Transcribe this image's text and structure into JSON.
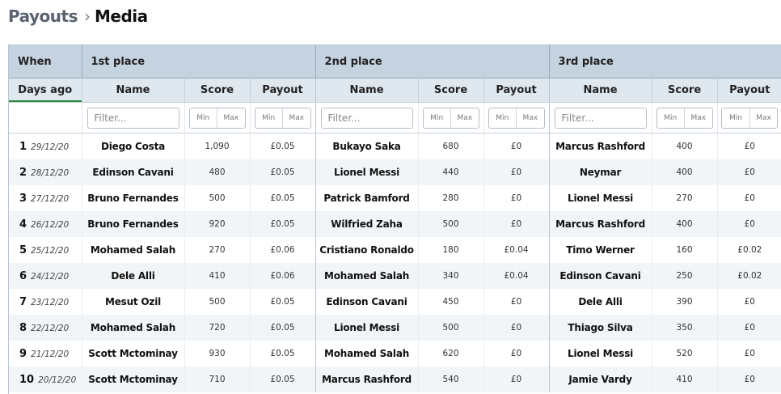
{
  "breadcrumb": {
    "parent": "Payouts",
    "separator": "›",
    "current": "Media"
  },
  "table": {
    "groups": [
      "When",
      "1st place",
      "2nd place",
      "3rd place"
    ],
    "columns": [
      "Days ago",
      "Name",
      "Score",
      "Payout",
      "Name",
      "Score",
      "Payout",
      "Name",
      "Score",
      "Payout"
    ],
    "filters": {
      "text_placeholder": "Filter...",
      "min_placeholder": "Min",
      "max_placeholder": "Max"
    },
    "rows": [
      {
        "rank": "1",
        "date": "29/12/20",
        "first": {
          "name": "Diego Costa",
          "score": "1,090",
          "payout": "£0.05"
        },
        "second": {
          "name": "Bukayo Saka",
          "score": "680",
          "payout": "£0"
        },
        "third": {
          "name": "Marcus Rashford",
          "score": "400",
          "payout": "£0"
        }
      },
      {
        "rank": "2",
        "date": "28/12/20",
        "first": {
          "name": "Edinson Cavani",
          "score": "480",
          "payout": "£0.05"
        },
        "second": {
          "name": "Lionel Messi",
          "score": "440",
          "payout": "£0"
        },
        "third": {
          "name": "Neymar",
          "score": "400",
          "payout": "£0"
        }
      },
      {
        "rank": "3",
        "date": "27/12/20",
        "first": {
          "name": "Bruno Fernandes",
          "score": "500",
          "payout": "£0.05"
        },
        "second": {
          "name": "Patrick Bamford",
          "score": "280",
          "payout": "£0"
        },
        "third": {
          "name": "Lionel Messi",
          "score": "270",
          "payout": "£0"
        }
      },
      {
        "rank": "4",
        "date": "26/12/20",
        "first": {
          "name": "Bruno Fernandes",
          "score": "920",
          "payout": "£0.05"
        },
        "second": {
          "name": "Wilfried Zaha",
          "score": "500",
          "payout": "£0"
        },
        "third": {
          "name": "Marcus Rashford",
          "score": "400",
          "payout": "£0"
        }
      },
      {
        "rank": "5",
        "date": "25/12/20",
        "first": {
          "name": "Mohamed Salah",
          "score": "270",
          "payout": "£0.06"
        },
        "second": {
          "name": "Cristiano Ronaldo",
          "score": "180",
          "payout": "£0.04"
        },
        "third": {
          "name": "Timo Werner",
          "score": "160",
          "payout": "£0.02"
        }
      },
      {
        "rank": "6",
        "date": "24/12/20",
        "first": {
          "name": "Dele Alli",
          "score": "410",
          "payout": "£0.06"
        },
        "second": {
          "name": "Mohamed Salah",
          "score": "340",
          "payout": "£0.04"
        },
        "third": {
          "name": "Edinson Cavani",
          "score": "250",
          "payout": "£0.02"
        }
      },
      {
        "rank": "7",
        "date": "23/12/20",
        "first": {
          "name": "Mesut Ozil",
          "score": "500",
          "payout": "£0.05"
        },
        "second": {
          "name": "Edinson Cavani",
          "score": "450",
          "payout": "£0"
        },
        "third": {
          "name": "Dele Alli",
          "score": "390",
          "payout": "£0"
        }
      },
      {
        "rank": "8",
        "date": "22/12/20",
        "first": {
          "name": "Mohamed Salah",
          "score": "720",
          "payout": "£0.05"
        },
        "second": {
          "name": "Lionel Messi",
          "score": "500",
          "payout": "£0"
        },
        "third": {
          "name": "Thiago Silva",
          "score": "350",
          "payout": "£0"
        }
      },
      {
        "rank": "9",
        "date": "21/12/20",
        "first": {
          "name": "Scott Mctominay",
          "score": "930",
          "payout": "£0.05"
        },
        "second": {
          "name": "Mohamed Salah",
          "score": "620",
          "payout": "£0"
        },
        "third": {
          "name": "Lionel Messi",
          "score": "520",
          "payout": "£0"
        }
      },
      {
        "rank": "10",
        "date": "20/12/20",
        "first": {
          "name": "Scott Mctominay",
          "score": "710",
          "payout": "£0.05"
        },
        "second": {
          "name": "Marcus Rashford",
          "score": "540",
          "payout": "£0"
        },
        "third": {
          "name": "Jamie Vardy",
          "score": "410",
          "payout": "£0"
        }
      }
    ]
  },
  "colors": {
    "header_group": "#c5d2df",
    "header_col": "#dfe7ef",
    "sort_indicator": "#2e8a3f",
    "row_stripe": "#f2f5f8"
  }
}
